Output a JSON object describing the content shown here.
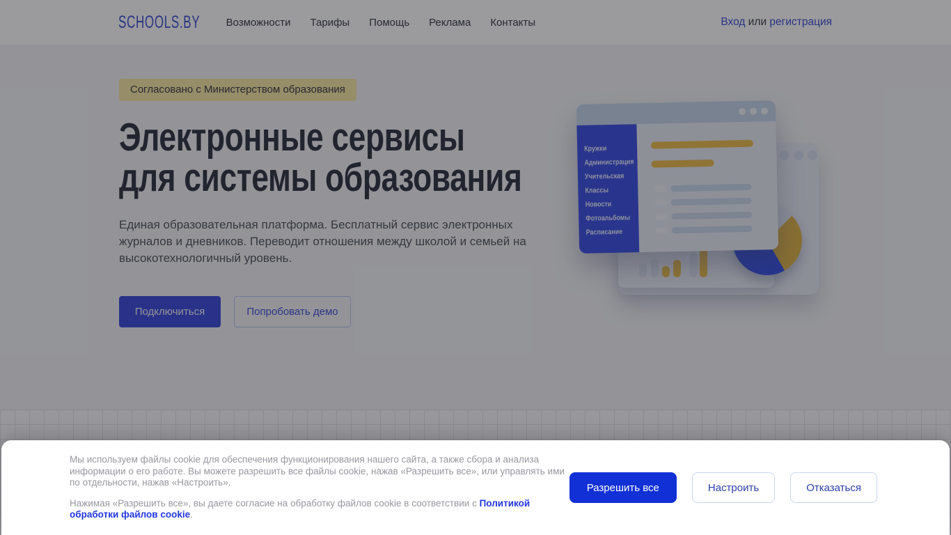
{
  "nav": {
    "logo": "SCHOOLS.BY",
    "items": [
      "Возможности",
      "Тарифы",
      "Помощь",
      "Реклама",
      "Контакты"
    ],
    "auth": {
      "login": "Вход",
      "or": " или ",
      "register": "регистрация"
    }
  },
  "hero": {
    "badge": "Согласовано с Министерством образования",
    "title_line1": "Электронные сервисы",
    "title_line2": "для системы образования",
    "description": "Единая образовательная платформа. Бесплатный сервис электронных журналов и дневников. Переводит отношения между школой и семьей на высокотехнологичный уровень.",
    "primary_button": "Подключиться",
    "secondary_button": "Попробовать демо"
  },
  "illustration": {
    "menu_items": [
      "Кружки",
      "Администрация",
      "Учительская",
      "Классы",
      "Новости",
      "Фотоальбомы",
      "Расписание"
    ]
  },
  "cookie_banner": {
    "paragraph1": "Мы используем файлы cookie для обеспечения функционирования нашего сайта, а также сбора и анализа информации о его работе. Вы можете разрешить все файлы cookie, нажав «Разрешить все», или управлять ими по отдельности, нажав «Настроить».",
    "paragraph2_prefix": "Нажимая «Разрешить все», вы даете согласие на обработку файлов cookie в соответствии с ",
    "policy_link": "Политикой обработки файлов cookie",
    "paragraph2_suffix": ".",
    "buttons": {
      "allow": "Разрешить все",
      "configure": "Настроить",
      "decline": "Отказаться"
    }
  },
  "colors": {
    "brand_blue": "#4252d6",
    "sidebar_blue": "#4156e5",
    "accent_yellow": "#ecbf52",
    "badge_yellow": "#f7e8a9",
    "cookie_allow_blue": "#1130d6",
    "policy_link_blue": "#2136e0",
    "pie_blue": "#3b55e6"
  }
}
